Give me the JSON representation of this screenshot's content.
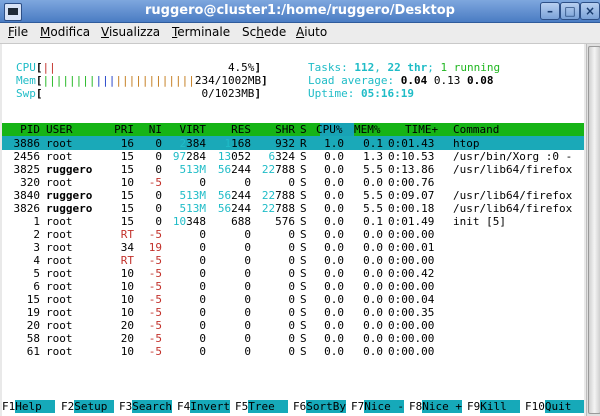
{
  "window": {
    "title": "ruggero@cluster1:/home/ruggero/Desktop"
  },
  "menubar": {
    "items": [
      {
        "label": "File",
        "u": "F",
        "rest": "ile"
      },
      {
        "label": "Modifica",
        "u": "M",
        "rest": "odifica"
      },
      {
        "label": "Visualizza",
        "u": "V",
        "rest": "isualizza"
      },
      {
        "label": "Terminale",
        "u": "T",
        "rest": "erminale"
      },
      {
        "label": "Schede",
        "pre": "Sc",
        "u": "h",
        "rest": "ede"
      },
      {
        "label": "Aiuto",
        "u": "A",
        "rest": "iuto"
      }
    ]
  },
  "meters": {
    "cpu": {
      "label": "CPU",
      "bar": "||",
      "value": "4.5%"
    },
    "mem": {
      "label": "Mem",
      "bar_green": "||||||||",
      "bar_blue": "|||",
      "bar_orange": "||||||||||||",
      "value": "234/1002MB"
    },
    "swp": {
      "label": "Swp",
      "value": "0/1023MB"
    }
  },
  "stats": {
    "tasks_label": "Tasks: ",
    "tasks": "112",
    "comma": ", ",
    "thr": "22 thr",
    "semi": "; ",
    "running": "1 running",
    "load_label": "Load average: ",
    "load1": "0.04",
    "load5": "0.13",
    "load15": "0.08",
    "uptime_label": "Uptime: ",
    "uptime": "05:16:19"
  },
  "table": {
    "columns": [
      "PID",
      "USER",
      "PRI",
      "NI",
      "VIRT",
      "RES",
      "SHR",
      "S",
      "CPU%",
      "MEM%",
      "TIME+",
      "Command"
    ],
    "rows": [
      {
        "pid": "3886",
        "user": "root",
        "pri": "16",
        "ni": "0",
        "virt": "2384",
        "res": "1168",
        "shr": "932",
        "s": "R",
        "cpu": "1.0",
        "mem": "0.1",
        "time": "0:01.43",
        "cmd": "htop"
      },
      {
        "pid": "2456",
        "user": "root",
        "pri": "15",
        "ni": "0",
        "virt": "97284",
        "res": "13052",
        "shr": "6324",
        "s": "S",
        "cpu": "0.0",
        "mem": "1.3",
        "time": "0:10.53",
        "cmd": "/usr/bin/Xorg :0 -"
      },
      {
        "pid": "3825",
        "user": "ruggero",
        "pri": "15",
        "ni": "0",
        "virt": "513M",
        "res": "56244",
        "shr": "22788",
        "s": "S",
        "cpu": "0.0",
        "mem": "5.5",
        "time": "0:13.86",
        "cmd": "/usr/lib64/firefox"
      },
      {
        "pid": "320",
        "user": "root",
        "pri": "10",
        "ni": "-5",
        "virt": "0",
        "res": "0",
        "shr": "0",
        "s": "S",
        "cpu": "0.0",
        "mem": "0.0",
        "time": "0:00.76",
        "cmd": ""
      },
      {
        "pid": "3840",
        "user": "ruggero",
        "pri": "15",
        "ni": "0",
        "virt": "513M",
        "res": "56244",
        "shr": "22788",
        "s": "S",
        "cpu": "0.0",
        "mem": "5.5",
        "time": "0:09.07",
        "cmd": "/usr/lib64/firefox"
      },
      {
        "pid": "3826",
        "user": "ruggero",
        "pri": "15",
        "ni": "0",
        "virt": "513M",
        "res": "56244",
        "shr": "22788",
        "s": "S",
        "cpu": "0.0",
        "mem": "5.5",
        "time": "0:00.18",
        "cmd": "/usr/lib64/firefox"
      },
      {
        "pid": "1",
        "user": "root",
        "pri": "15",
        "ni": "0",
        "virt": "10348",
        "res": "688",
        "shr": "576",
        "s": "S",
        "cpu": "0.0",
        "mem": "0.1",
        "time": "0:01.49",
        "cmd": "init [5]"
      },
      {
        "pid": "2",
        "user": "root",
        "pri": "RT",
        "ni": "-5",
        "virt": "0",
        "res": "0",
        "shr": "0",
        "s": "S",
        "cpu": "0.0",
        "mem": "0.0",
        "time": "0:00.00",
        "cmd": ""
      },
      {
        "pid": "3",
        "user": "root",
        "pri": "34",
        "ni": "19",
        "virt": "0",
        "res": "0",
        "shr": "0",
        "s": "S",
        "cpu": "0.0",
        "mem": "0.0",
        "time": "0:00.01",
        "cmd": ""
      },
      {
        "pid": "4",
        "user": "root",
        "pri": "RT",
        "ni": "-5",
        "virt": "0",
        "res": "0",
        "shr": "0",
        "s": "S",
        "cpu": "0.0",
        "mem": "0.0",
        "time": "0:00.00",
        "cmd": ""
      },
      {
        "pid": "5",
        "user": "root",
        "pri": "10",
        "ni": "-5",
        "virt": "0",
        "res": "0",
        "shr": "0",
        "s": "S",
        "cpu": "0.0",
        "mem": "0.0",
        "time": "0:00.42",
        "cmd": ""
      },
      {
        "pid": "6",
        "user": "root",
        "pri": "10",
        "ni": "-5",
        "virt": "0",
        "res": "0",
        "shr": "0",
        "s": "S",
        "cpu": "0.0",
        "mem": "0.0",
        "time": "0:00.00",
        "cmd": ""
      },
      {
        "pid": "15",
        "user": "root",
        "pri": "10",
        "ni": "-5",
        "virt": "0",
        "res": "0",
        "shr": "0",
        "s": "S",
        "cpu": "0.0",
        "mem": "0.0",
        "time": "0:00.04",
        "cmd": ""
      },
      {
        "pid": "19",
        "user": "root",
        "pri": "10",
        "ni": "-5",
        "virt": "0",
        "res": "0",
        "shr": "0",
        "s": "S",
        "cpu": "0.0",
        "mem": "0.0",
        "time": "0:00.35",
        "cmd": ""
      },
      {
        "pid": "20",
        "user": "root",
        "pri": "20",
        "ni": "-5",
        "virt": "0",
        "res": "0",
        "shr": "0",
        "s": "S",
        "cpu": "0.0",
        "mem": "0.0",
        "time": "0:00.00",
        "cmd": ""
      },
      {
        "pid": "58",
        "user": "root",
        "pri": "20",
        "ni": "-5",
        "virt": "0",
        "res": "0",
        "shr": "0",
        "s": "S",
        "cpu": "0.0",
        "mem": "0.0",
        "time": "0:00.00",
        "cmd": ""
      },
      {
        "pid": "61",
        "user": "root",
        "pri": "10",
        "ni": "-5",
        "virt": "0",
        "res": "0",
        "shr": "0",
        "s": "S",
        "cpu": "0.0",
        "mem": "0.0",
        "time": "0:00.00",
        "cmd": ""
      }
    ]
  },
  "footer": [
    {
      "key": "F1",
      "label": "Help  "
    },
    {
      "key": "F2",
      "label": "Setup "
    },
    {
      "key": "F3",
      "label": "Search"
    },
    {
      "key": "F4",
      "label": "Invert"
    },
    {
      "key": "F5",
      "label": "Tree  "
    },
    {
      "key": "F6",
      "label": "SortBy"
    },
    {
      "key": "F7",
      "label": "Nice -"
    },
    {
      "key": "F8",
      "label": "Nice +"
    },
    {
      "key": "F9",
      "label": "Kill  "
    },
    {
      "key": "F10",
      "label": "Quit  "
    }
  ],
  "colors": {
    "header_bg": "#16b416",
    "selected_bg": "#1aa9b8",
    "accent_cyan": "#1fbcc7",
    "nice_red": "#c2302a"
  }
}
